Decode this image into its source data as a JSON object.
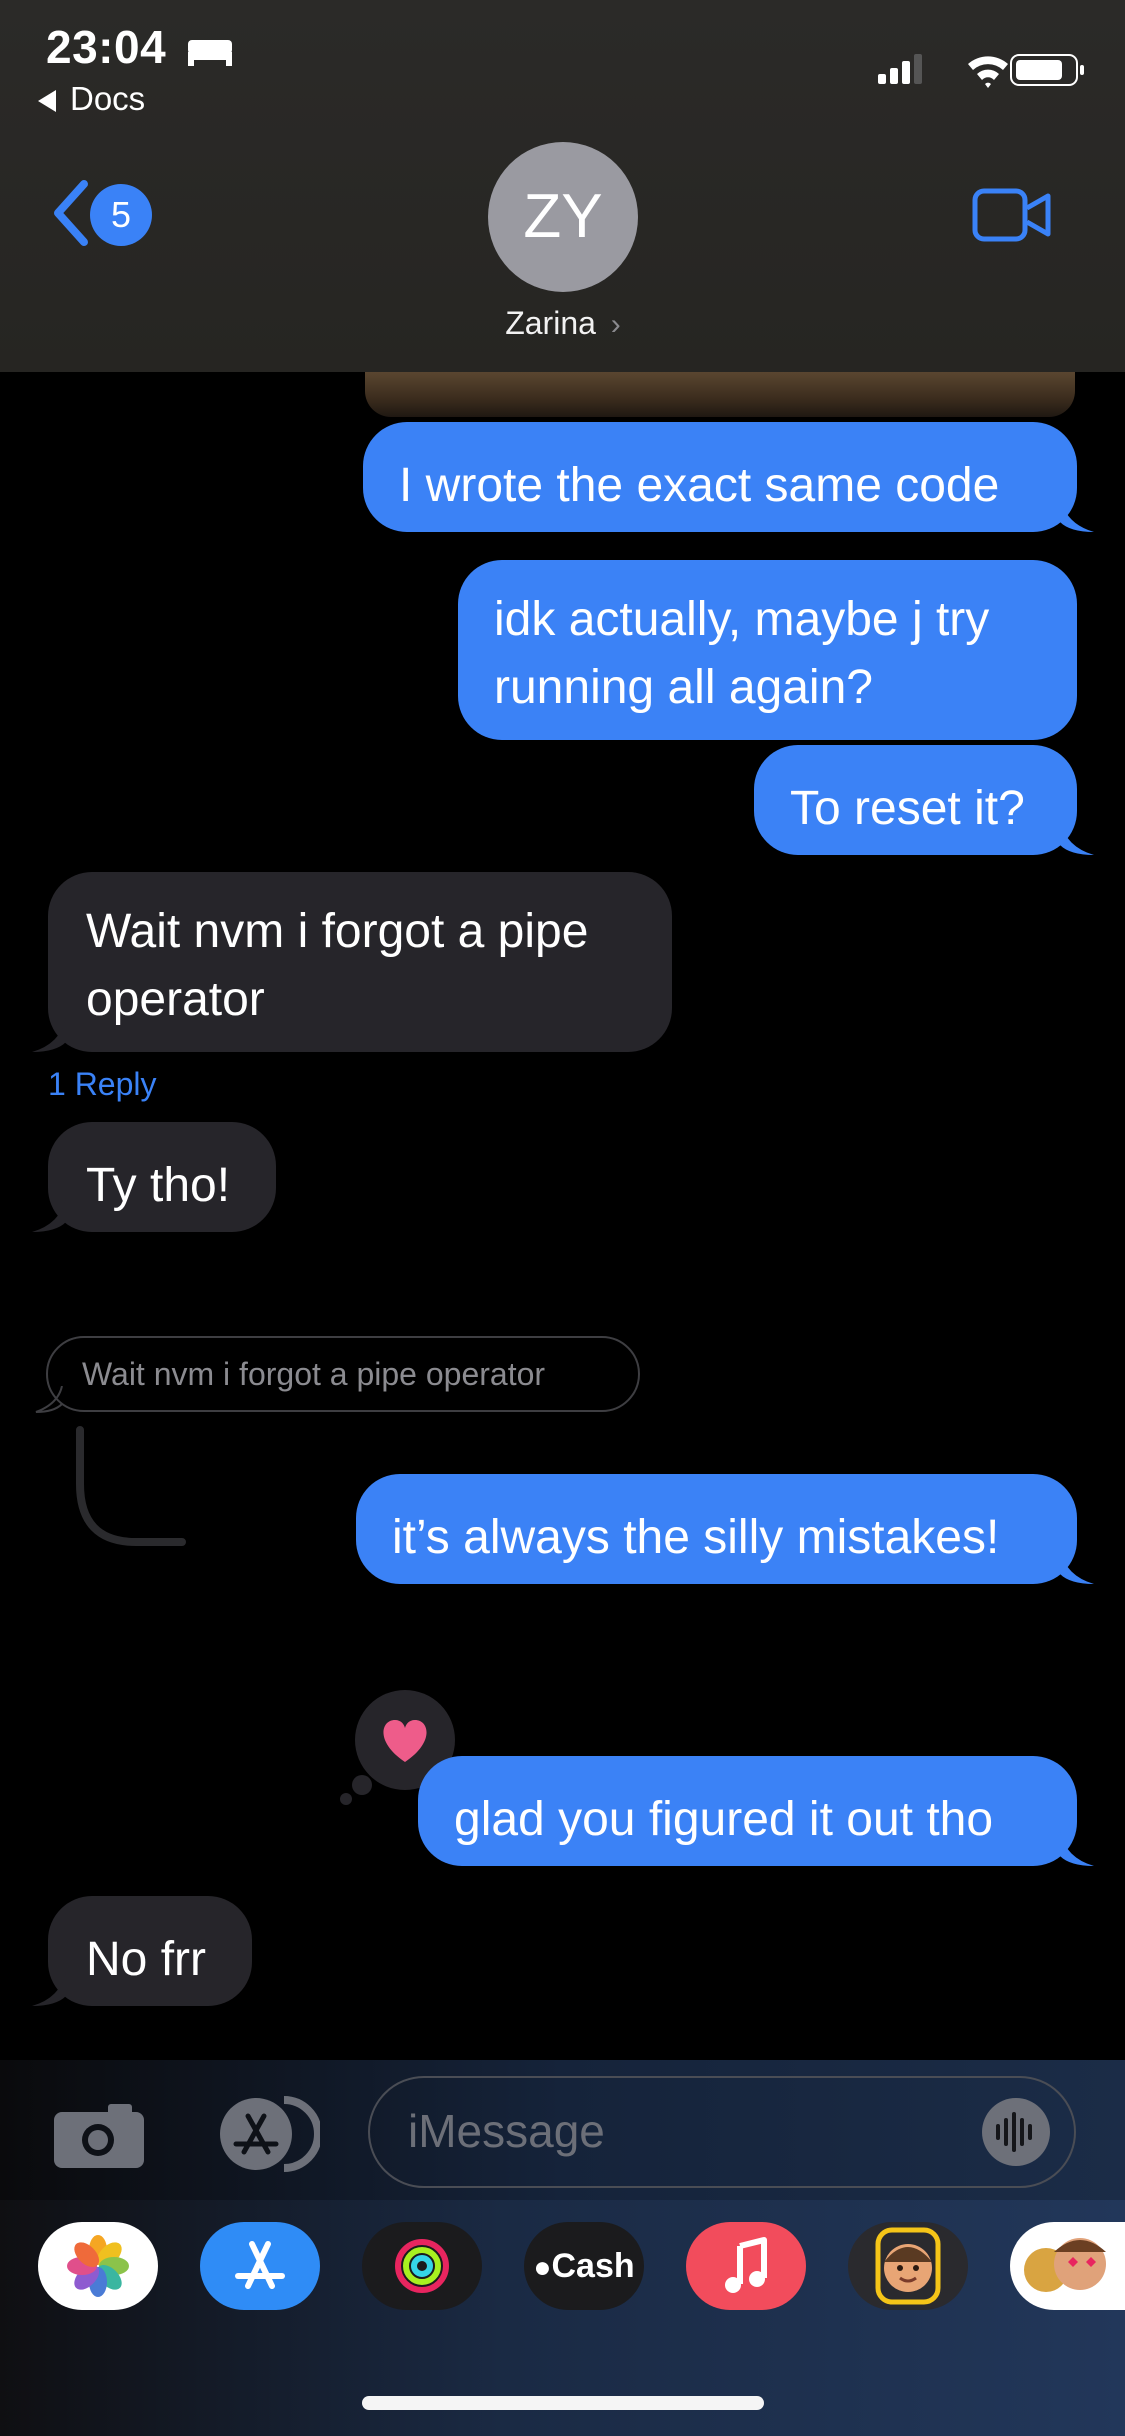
{
  "status_bar": {
    "time": "23:04",
    "back_app": "Docs"
  },
  "header": {
    "back_badge": "5",
    "avatar_initials": "ZY",
    "contact_name": "Zarina"
  },
  "messages": [
    {
      "from": "me",
      "text": "I wrote the exact same code"
    },
    {
      "from": "me",
      "text": "idk actually, maybe j try running all again?"
    },
    {
      "from": "me",
      "text": "To reset it?"
    },
    {
      "from": "them",
      "text": "Wait nvm i forgot a pipe operator"
    },
    {
      "from": "them",
      "text": "Ty tho!"
    },
    {
      "from": "me",
      "text": "it’s always the silly mistakes!"
    },
    {
      "from": "me",
      "text": "glad you figured it out tho",
      "reaction": "heart"
    },
    {
      "from": "them",
      "text": "No frr"
    }
  ],
  "thread": {
    "reply_count": "1 Reply",
    "quoted_text": "Wait nvm i forgot a pipe operator"
  },
  "composer": {
    "placeholder": "iMessage"
  },
  "app_drawer": [
    {
      "name": "photos-app",
      "label": ""
    },
    {
      "name": "app-store-app",
      "label": ""
    },
    {
      "name": "fitness-app",
      "label": ""
    },
    {
      "name": "cash-app",
      "label": "Cash"
    },
    {
      "name": "music-app",
      "label": ""
    },
    {
      "name": "memoji-app",
      "label": ""
    },
    {
      "name": "animoji-app",
      "label": ""
    }
  ],
  "colors": {
    "bubble_out": "#3b82f6",
    "bubble_in": "#26252a",
    "accent": "#3a82f7",
    "heart": "#ee5c8a"
  }
}
